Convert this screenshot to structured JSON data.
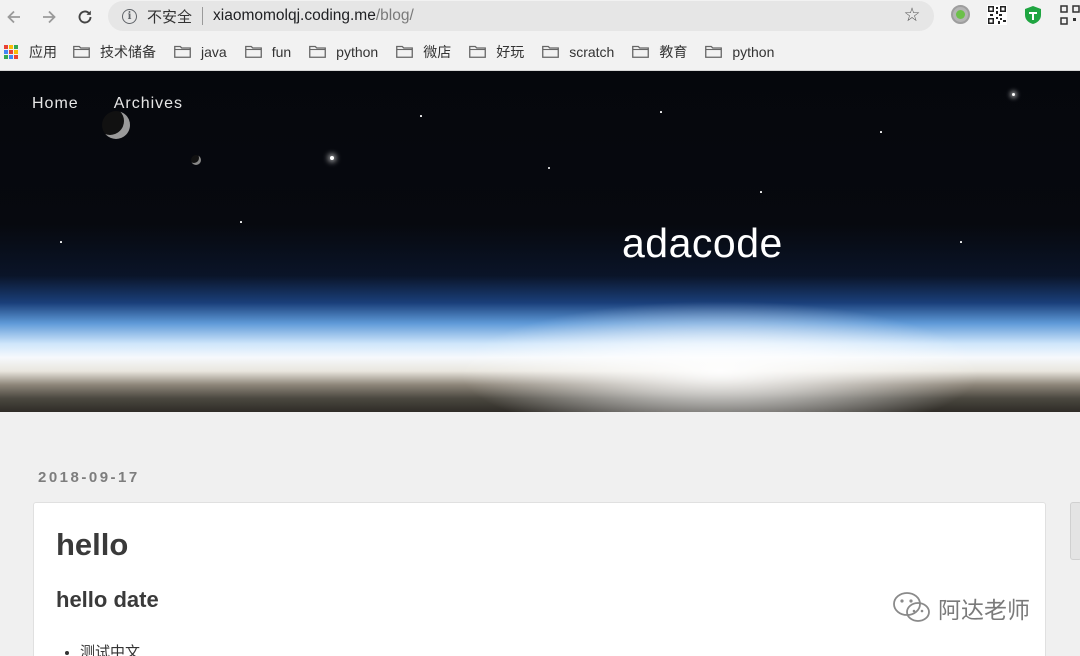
{
  "browser": {
    "security_label": "不安全",
    "url_host": "xiaomomolqj.coding.me",
    "url_path": "/blog/"
  },
  "bookmarks": {
    "apps_label": "应用",
    "items": [
      "技术储备",
      "java",
      "fun",
      "python",
      "微店",
      "好玩",
      "scratch",
      "教育",
      "python"
    ]
  },
  "hero": {
    "nav": [
      "Home",
      "Archives"
    ],
    "title": "adacode"
  },
  "post": {
    "date": "2018-09-17",
    "title": "hello",
    "subtitle": "hello date",
    "list": [
      "测试中文"
    ]
  },
  "watermark": {
    "text": "阿达老师"
  }
}
